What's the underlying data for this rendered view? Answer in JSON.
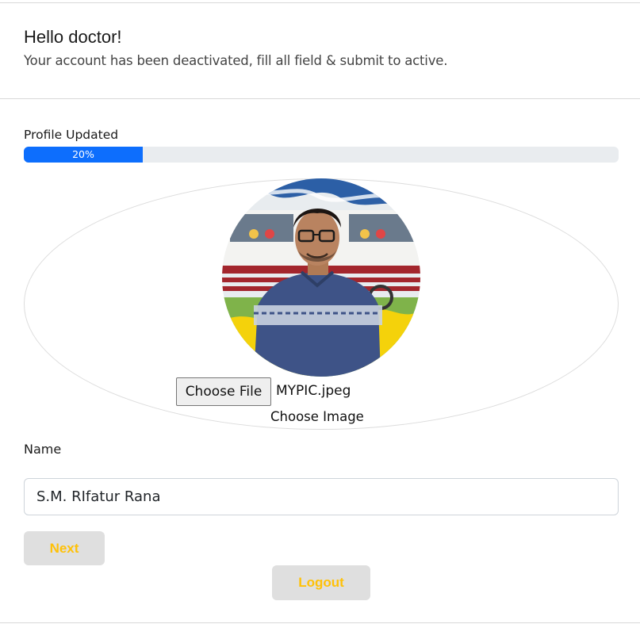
{
  "header": {
    "greeting": "Hello doctor!",
    "subtitle": "Your account has been deactivated, fill all field & submit to active."
  },
  "progress": {
    "label": "Profile Updated",
    "value_text": "20%",
    "value": 20,
    "fill_color": "#0d6efd"
  },
  "profile_image": {
    "icon": "profile-photo",
    "file_button_label": "Choose File",
    "file_name": "MYPIC.jpeg",
    "caption": "Choose Image"
  },
  "form": {
    "name_label": "Name",
    "name_value": "S.M. RIfatur Rana"
  },
  "buttons": {
    "next_label": "Next",
    "logout_label": "Logout",
    "text_color": "#ffc107",
    "bg_color": "#dfdfdf"
  }
}
